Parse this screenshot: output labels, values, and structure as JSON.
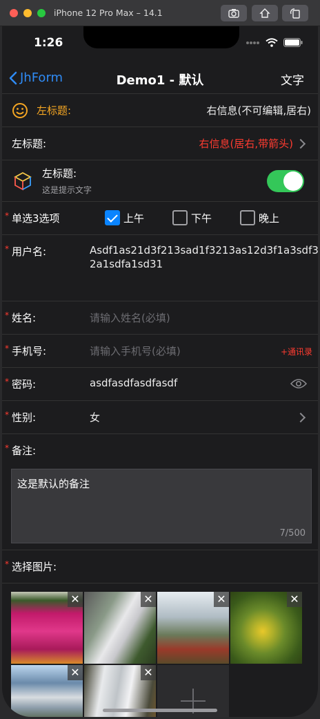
{
  "simulator": {
    "title": "iPhone 12 Pro Max – 14.1"
  },
  "status": {
    "time": "1:26"
  },
  "nav": {
    "back_label": "JhForm",
    "title": "Demo1 - 默认",
    "right_label": "文字"
  },
  "rows": {
    "row1": {
      "left": "左标题:",
      "right": "右信息(不可编辑,居右)"
    },
    "row2": {
      "left": "左标题:",
      "right": "右信息(居右,带箭头)"
    },
    "row3": {
      "left": "左标题:",
      "hint": "这是提示文字",
      "switch_on": true
    },
    "single_select": {
      "label": "单选3选项",
      "options": [
        {
          "label": "上午",
          "checked": true
        },
        {
          "label": "下午",
          "checked": false
        },
        {
          "label": "晚上",
          "checked": false
        }
      ]
    },
    "username": {
      "label": "用户名:",
      "value_line1": "Asdf1as21d3f213sad1f3213as12d3f1a3sdf3",
      "value_line2": "2a1sdfa1sd31"
    },
    "name": {
      "label": "姓名:",
      "placeholder": "请输入姓名(必填)"
    },
    "phone": {
      "label": "手机号:",
      "placeholder": "请输入手机号(必填)",
      "action": "+通讯录"
    },
    "password": {
      "label": "密码:",
      "value": "asdfasdfasdfasdf"
    },
    "gender": {
      "label": "性别:",
      "value": "女"
    },
    "remark": {
      "label": "备注:",
      "value": "这是默认的备注",
      "counter": "7/500"
    },
    "images": {
      "label": "选择图片:",
      "remove_symbol": "✕"
    }
  },
  "colors": {
    "accent": "#2f8bf5",
    "orange": "#f5a623",
    "red": "#ff3b30",
    "switch": "#34c759"
  }
}
